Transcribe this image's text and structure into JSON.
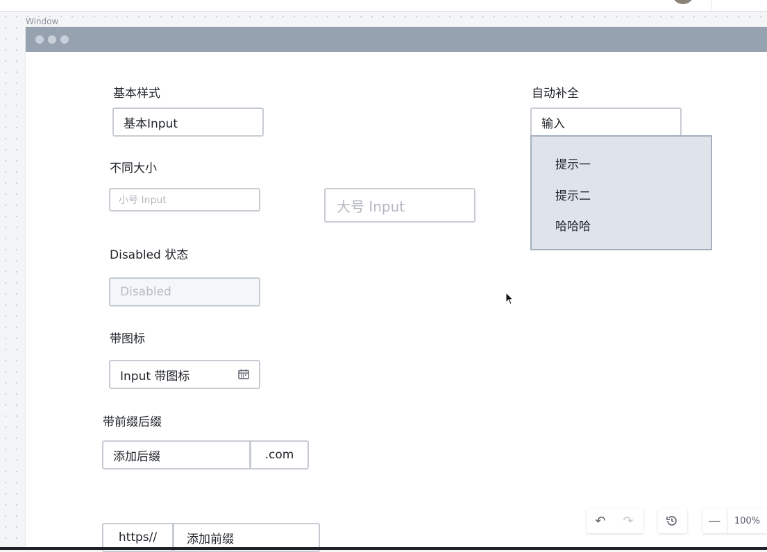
{
  "window": {
    "title": "Window"
  },
  "sections": {
    "basic": {
      "label": "基本样式",
      "value": "基本Input"
    },
    "sizes": {
      "label": "不同大小",
      "small_placeholder": "小号 Input",
      "large_placeholder": "大号 Input"
    },
    "disabled": {
      "label": "Disabled 状态",
      "value": "Disabled"
    },
    "icon": {
      "label": "带图标",
      "value": "Input 带图标",
      "icon": "calendar-icon"
    },
    "affix": {
      "label": "带前缀后缀",
      "suffix_input": "添加后缀",
      "suffix": ".com",
      "prefix": "https//",
      "prefix_input": "添加前缀"
    },
    "autocomplete": {
      "label": "自动补全",
      "value": "输入",
      "options": [
        "提示一",
        "提示二",
        "哈哈哈"
      ]
    }
  },
  "toolbar": {
    "zoom": "100%",
    "icons": [
      "undo-icon",
      "redo-icon",
      "history-icon",
      "zoom-out-icon"
    ]
  },
  "colors": {
    "titlebar": "#97a2b1",
    "dropdown_bg": "#dfe3ea",
    "border": "#c7ccd3"
  }
}
